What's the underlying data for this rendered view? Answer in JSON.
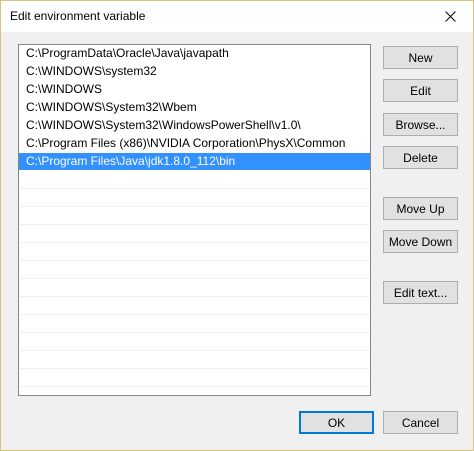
{
  "window": {
    "title": "Edit environment variable"
  },
  "paths": [
    "C:\\ProgramData\\Oracle\\Java\\javapath",
    "C:\\WINDOWS\\system32",
    "C:\\WINDOWS",
    "C:\\WINDOWS\\System32\\Wbem",
    "C:\\WINDOWS\\System32\\WindowsPowerShell\\v1.0\\",
    "C:\\Program Files (x86)\\NVIDIA Corporation\\PhysX\\Common",
    "C:\\Program Files\\Java\\jdk1.8.0_112\\bin"
  ],
  "selected_index": 6,
  "buttons": {
    "new": "New",
    "edit": "Edit",
    "browse": "Browse...",
    "delete": "Delete",
    "move_up": "Move Up",
    "move_down": "Move Down",
    "edit_text": "Edit text...",
    "ok": "OK",
    "cancel": "Cancel"
  },
  "colors": {
    "selection": "#3390ff",
    "default_button_border": "#0078d7"
  },
  "icons": {
    "close": "close-icon"
  }
}
